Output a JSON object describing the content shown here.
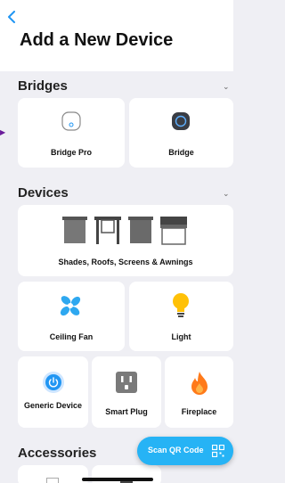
{
  "header": {
    "title": "Add a New Device",
    "back_icon": "chevron-left-icon"
  },
  "sections": {
    "bridges": {
      "title": "Bridges",
      "items": [
        {
          "label": "Bridge Pro",
          "icon": "bridge-pro-icon"
        },
        {
          "label": "Bridge",
          "icon": "bridge-icon"
        }
      ]
    },
    "devices": {
      "title": "Devices",
      "items": [
        {
          "label": "Shades, Roofs, Screens & Awnings",
          "icon": "shades-icon"
        },
        {
          "label": "Ceiling Fan",
          "icon": "fan-icon"
        },
        {
          "label": "Light",
          "icon": "bulb-icon"
        },
        {
          "label": "Generic Device",
          "icon": "power-icon"
        },
        {
          "label": "Smart Plug",
          "icon": "plug-icon"
        },
        {
          "label": "Fireplace",
          "icon": "flame-icon"
        }
      ]
    },
    "accessories": {
      "title": "Accessories"
    }
  },
  "scan": {
    "label": "Scan QR Code",
    "icon": "qr-code-icon"
  },
  "colors": {
    "accent": "#2196f3",
    "scan_button": "#26b3f5",
    "fan": "#2ea8f0",
    "bulb": "#ffc107",
    "flame": "#ff7a1a",
    "background": "#efeff4"
  }
}
